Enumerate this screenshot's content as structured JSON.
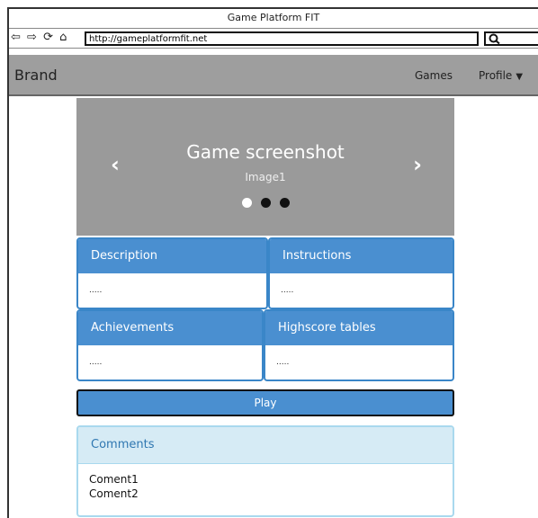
{
  "window": {
    "title": "Game Platform FIT"
  },
  "address_bar": {
    "url": "http://gameplatformfit.net",
    "search_icon": "search-icon",
    "back_icon": "⇦",
    "forward_icon": "⇨",
    "reload_icon": "⟳",
    "home_icon": "⌂"
  },
  "navbar": {
    "brand": "Brand",
    "games": "Games",
    "profile": "Profile",
    "caret": "▼"
  },
  "carousel": {
    "title": "Game screenshot",
    "subtitle": "Image1",
    "prev": "‹",
    "next": "›",
    "slide_count": 3,
    "active_index": 0
  },
  "panels": [
    {
      "title": "Description",
      "body": "....."
    },
    {
      "title": "Instructions",
      "body": "....."
    },
    {
      "title": "Achievements",
      "body": "....."
    },
    {
      "title": "Highscore tables",
      "body": "....."
    }
  ],
  "play_label": "Play",
  "comments": {
    "title": "Comments",
    "items": [
      "Coment1",
      "Coment2"
    ]
  },
  "colors": {
    "navbar": "#9e9e9e",
    "carousel": "#9a9a9a",
    "panel_header": "#4a8fd0",
    "comments_header": "#d6ebf5"
  }
}
